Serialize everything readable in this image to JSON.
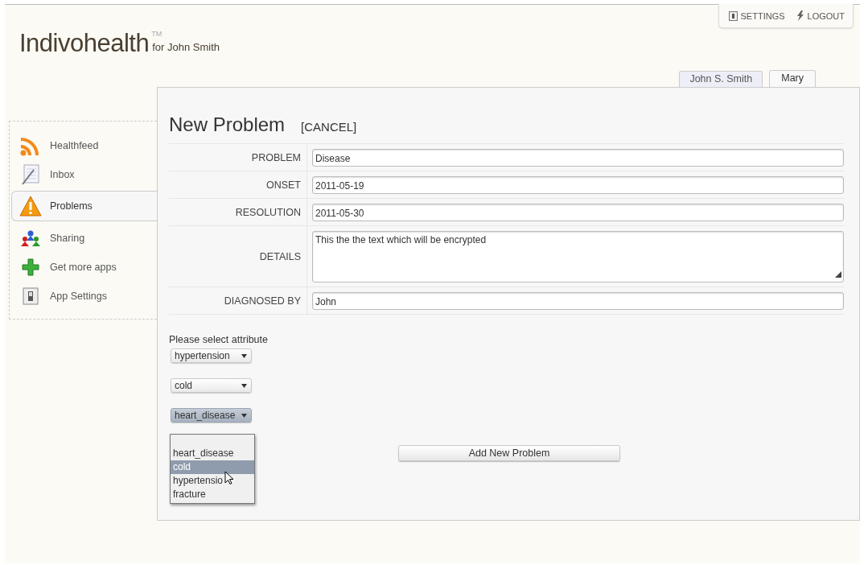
{
  "header": {
    "logo": "Indivohealth",
    "trademark": "TM",
    "subtitle": "for John Smith"
  },
  "top_links": [
    "SETTINGS",
    "LOGOUT"
  ],
  "account_tabs": [
    {
      "label": "John S. Smith",
      "selected": false
    },
    {
      "label": "Mary",
      "selected": true
    }
  ],
  "sidebar": {
    "items": [
      {
        "label": "Healthfeed",
        "selected": false
      },
      {
        "label": "Inbox",
        "selected": false
      },
      {
        "label": "Problems",
        "selected": true
      },
      {
        "label": "Sharing",
        "selected": false
      },
      {
        "label": "Get more apps",
        "selected": false
      },
      {
        "label": "App Settings",
        "selected": false
      }
    ]
  },
  "form": {
    "title": "New Problem",
    "cancel": "[CANCEL]",
    "fields": [
      {
        "kind": "input",
        "label": "PROBLEM",
        "value": "Disease"
      },
      {
        "kind": "textarea_none",
        "label": "ONSET",
        "value": "2011-05-19"
      },
      {
        "kind": "input",
        "label": "RESOLUTION",
        "value": "2011-05-30"
      },
      {
        "kind": "textarea",
        "label": "DETAILS",
        "value": "This the the text which will be encrypted"
      },
      {
        "kind": "input",
        "label": "DIAGNOSED BY",
        "value": "John"
      }
    ]
  },
  "attribute_prompt": "Please select attribute",
  "selects": [
    {
      "value": "hypertension",
      "open": false
    },
    {
      "value": "cold",
      "open": false
    },
    {
      "value": "heart_disease",
      "open": true
    }
  ],
  "dropdown": {
    "options": [
      {
        "label": "heart_disease",
        "selected": false
      },
      {
        "label": "cold",
        "selected": true
      },
      {
        "label": "hypertensio",
        "selected": false
      },
      {
        "label": "fracture",
        "selected": false
      }
    ]
  },
  "submit_button": "Add New Problem"
}
